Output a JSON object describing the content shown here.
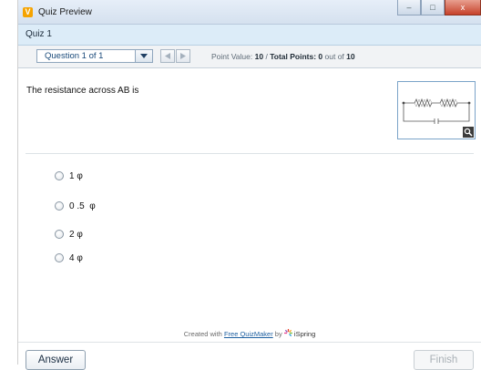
{
  "window": {
    "title": "Quiz Preview",
    "app_icon": "V",
    "controls": {
      "minimize": "–",
      "maximize": "□",
      "close": "x"
    }
  },
  "quiz": {
    "title": "Quiz 1"
  },
  "toolbar": {
    "question_select": "Question 1 of 1",
    "point_value_label": "Point Value:",
    "point_value": "10",
    "separator": "/",
    "total_points_label": "Total Points:",
    "total_points_value": "0",
    "total_points_suffix": "out of",
    "total_points_max": "10"
  },
  "question": {
    "text": "The resistance across AB is",
    "image_icons": [
      "circuit-diagram-icon",
      "zoom-icon"
    ]
  },
  "answers": [
    {
      "label": "1 φ",
      "selected": false
    },
    {
      "label": "0 .5  φ",
      "selected": false
    },
    {
      "label": "2 φ",
      "selected": false
    },
    {
      "label": "4 φ",
      "selected": false
    }
  ],
  "footer": {
    "created_with": "Created with",
    "product": "Free QuizMaker",
    "by": "by",
    "brand": "iSpring"
  },
  "buttons": {
    "answer": "Answer",
    "finish": "Finish"
  },
  "colors": {
    "title_bar": "#dbe6f2",
    "quiz_bar": "#dcecf8",
    "close_button": "#c7412a",
    "link": "#1d5fa0",
    "app_icon": "#f5a300"
  }
}
